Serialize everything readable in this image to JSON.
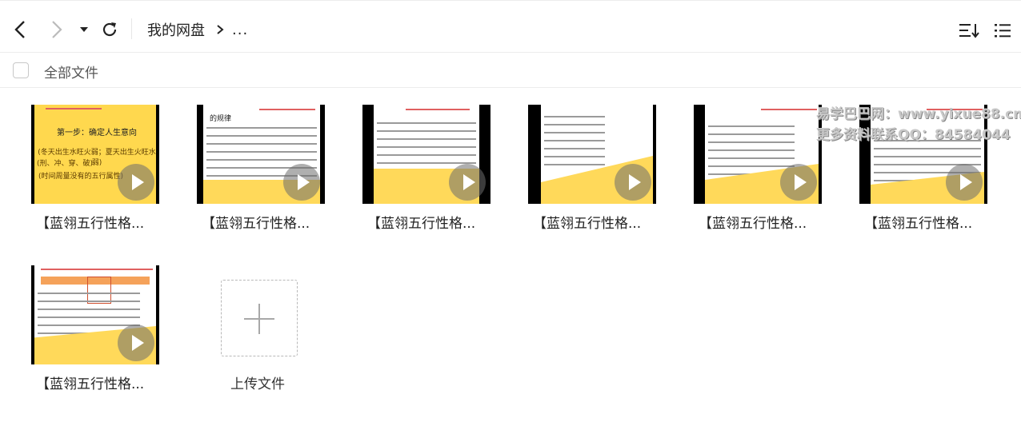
{
  "toolbar": {
    "breadcrumb_root": "我的网盘",
    "breadcrumb_more": "...",
    "icons": [
      "chevron-left-icon",
      "chevron-right-icon",
      "caret-down-icon",
      "refresh-icon",
      "sort-icon",
      "list-view-icon"
    ]
  },
  "select_all": {
    "label": "全部文件",
    "checked": false
  },
  "files": [
    {
      "name": "【蓝翎五行性格...",
      "type": "video"
    },
    {
      "name": "【蓝翎五行性格...",
      "type": "video"
    },
    {
      "name": "【蓝翎五行性格...",
      "type": "video"
    },
    {
      "name": "【蓝翎五行性格...",
      "type": "video"
    },
    {
      "name": "【蓝翎五行性格...",
      "type": "video"
    },
    {
      "name": "【蓝翎五行性格...",
      "type": "video"
    },
    {
      "name": "【蓝翎五行性格...",
      "type": "video"
    }
  ],
  "thumb_text": {
    "t1_title": "第一步：确定人生意向",
    "t1_line1": "(冬天出生水旺火弱；夏天出生火旺水弱)",
    "t1_line2": "(刑、冲、穿、破)",
    "t1_line3": "(时间周量没有的五行属性)",
    "t2_heading": "的规律"
  },
  "upload": {
    "label": "上传文件"
  },
  "watermark": {
    "line1": "易学巴巴网：www.yixue88.cn",
    "line2": "更多资料联系QQ：84584044"
  },
  "colors": {
    "thumb_yellow": "#ffd95a",
    "divider": "#ececec",
    "accent_text": "#222222"
  }
}
